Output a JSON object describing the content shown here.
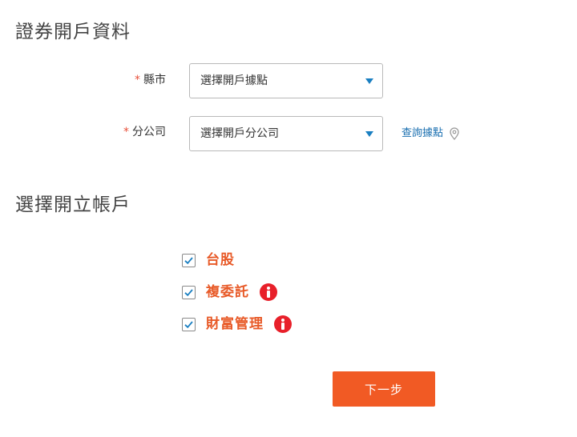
{
  "sections": {
    "account_info_title": "證券開戶資料",
    "open_accounts_title": "選擇開立帳戶"
  },
  "form": {
    "required_mark": "*",
    "city": {
      "label": "縣市",
      "value": "選擇開戶據點"
    },
    "branch": {
      "label": "分公司",
      "value": "選擇開戶分公司"
    },
    "query_link": "查詢據點"
  },
  "accounts": [
    {
      "label": "台股",
      "checked": true,
      "has_info": false
    },
    {
      "label": "複委託",
      "checked": true,
      "has_info": true
    },
    {
      "label": "財富管理",
      "checked": true,
      "has_info": true
    }
  ],
  "next_button": "下一步",
  "colors": {
    "accent": "#f15a24",
    "account_label": "#e85a28",
    "link": "#1a6fb0",
    "info_icon": "#e8202a",
    "checkmark": "#1a7fc1"
  },
  "icons": {
    "dropdown": "caret-down-icon",
    "location": "map-pin-icon",
    "check": "checkmark-icon",
    "info": "info-icon"
  }
}
